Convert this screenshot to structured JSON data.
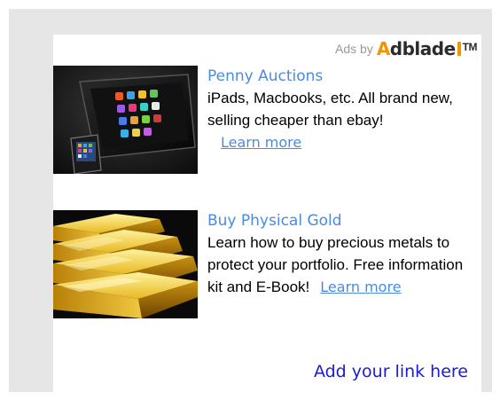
{
  "attribution": {
    "prefix": "Ads by",
    "brand_first_letter": "A",
    "brand_rest": "dblade",
    "trademark": "TM",
    "brand_color": "#f29400"
  },
  "ads": [
    {
      "title": "Penny Auctions",
      "description": "iPads, Macbooks, etc. All brand new, selling cheaper than ebay!",
      "cta": "Learn more",
      "image": "tablet-and-phone-image"
    },
    {
      "title": "Buy Physical Gold",
      "description": "Learn how to buy precious metals to protect your portfolio. Free information kit and E-Book!",
      "cta": "Learn more",
      "image": "gold-bars-image"
    }
  ],
  "footer": {
    "add_link_label": "Add your link here"
  },
  "colors": {
    "outer_background": "#e6e6e6",
    "panel_background": "#ffffff",
    "title_link": "#4a8be0",
    "add_link": "#1a1adb"
  }
}
